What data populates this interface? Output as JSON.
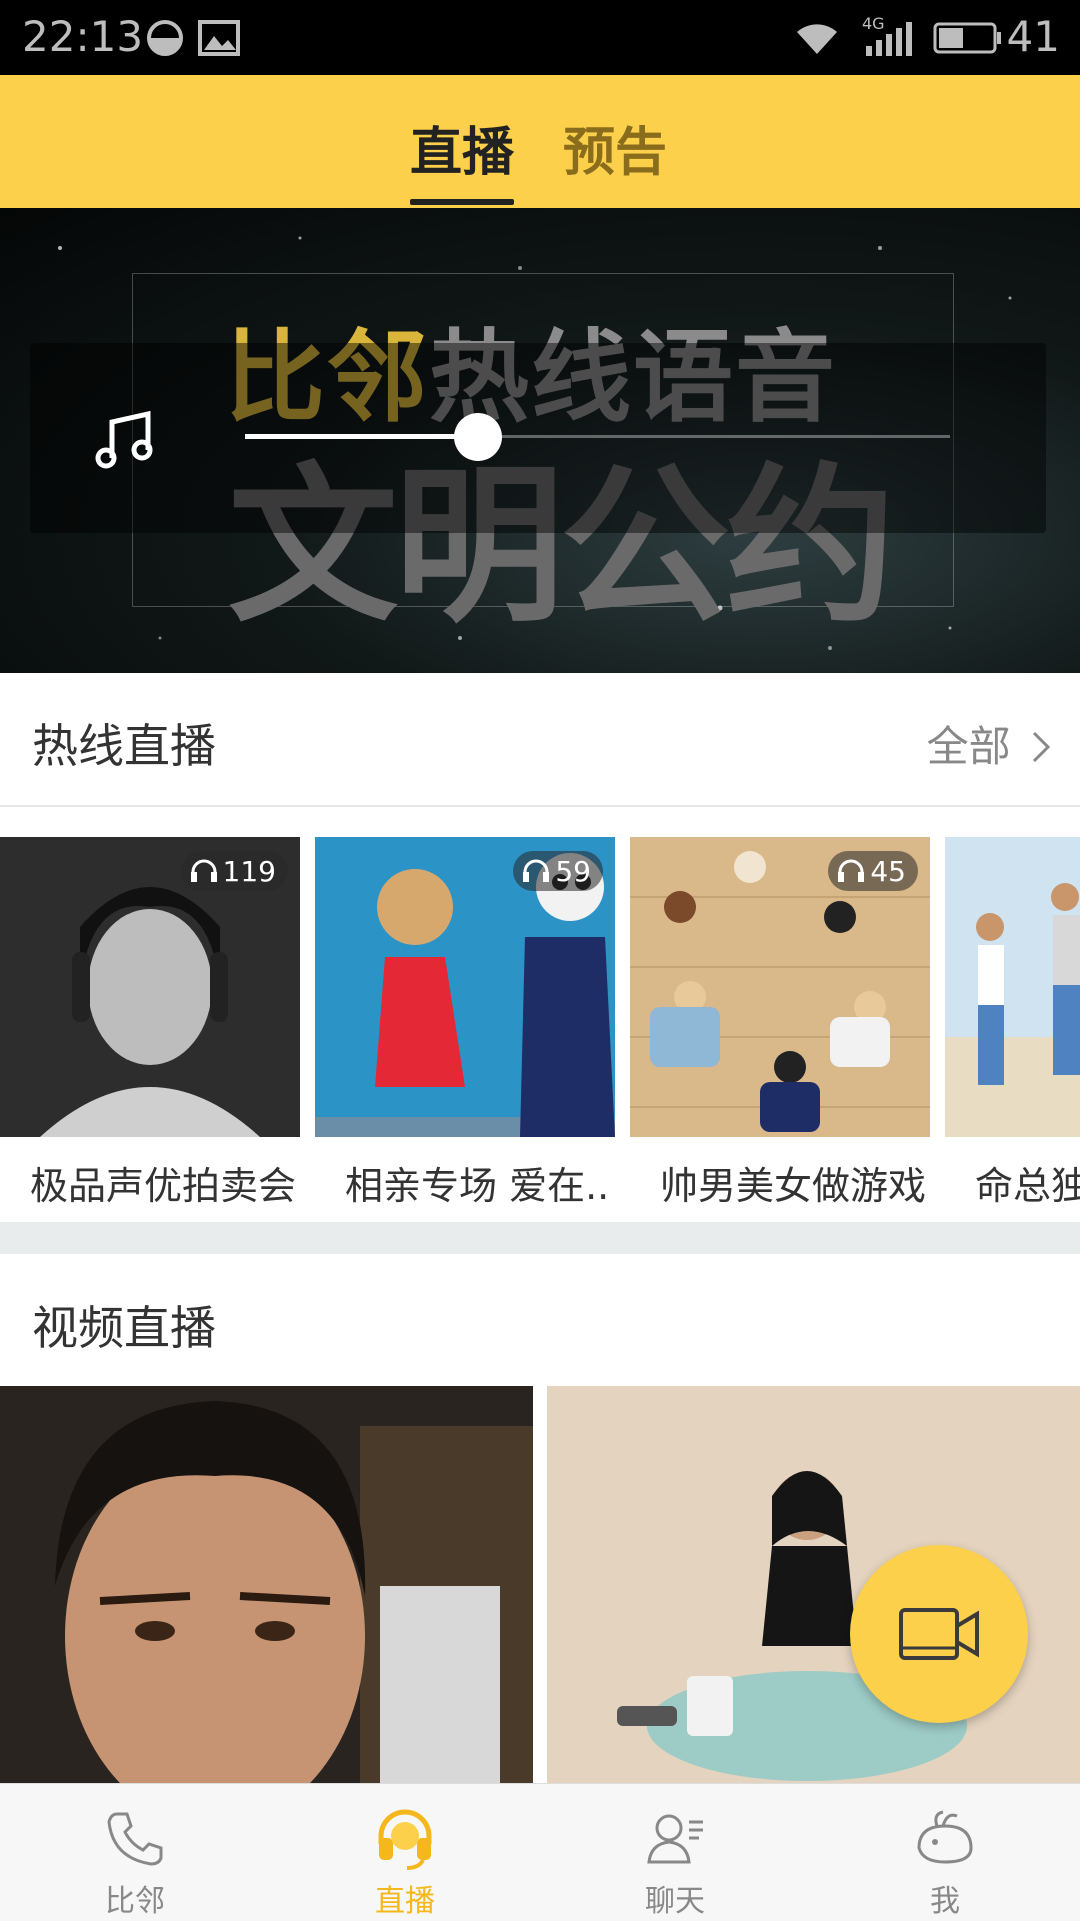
{
  "status_bar": {
    "time": "22:13",
    "network": "4G",
    "battery": "41"
  },
  "header": {
    "tabs": [
      {
        "label": "直播",
        "active": true
      },
      {
        "label": "预告",
        "active": false
      }
    ]
  },
  "banner": {
    "title_yellow": "比邻",
    "title_white": "热线语音",
    "subtitle": "文明公约",
    "progress": 0.33
  },
  "hotline": {
    "title": "热线直播",
    "see_all": "全部",
    "cards": [
      {
        "label": "极品声优拍卖会",
        "listeners": "119"
      },
      {
        "label": "相亲专场 爱在..",
        "listeners": "59"
      },
      {
        "label": "帅男美女做游戏",
        "listeners": "45"
      },
      {
        "label": "命总独"
      }
    ]
  },
  "video": {
    "title": "视频直播"
  },
  "nav": {
    "items": [
      {
        "label": "比邻",
        "icon": "phone-icon",
        "active": false
      },
      {
        "label": "直播",
        "icon": "headset-icon",
        "active": true
      },
      {
        "label": "聊天",
        "icon": "chat-person-icon",
        "active": false
      },
      {
        "label": "我",
        "icon": "whale-icon",
        "active": false
      }
    ]
  },
  "colors": {
    "accent": "#fcd04a",
    "active_nav": "#f5b81c"
  }
}
